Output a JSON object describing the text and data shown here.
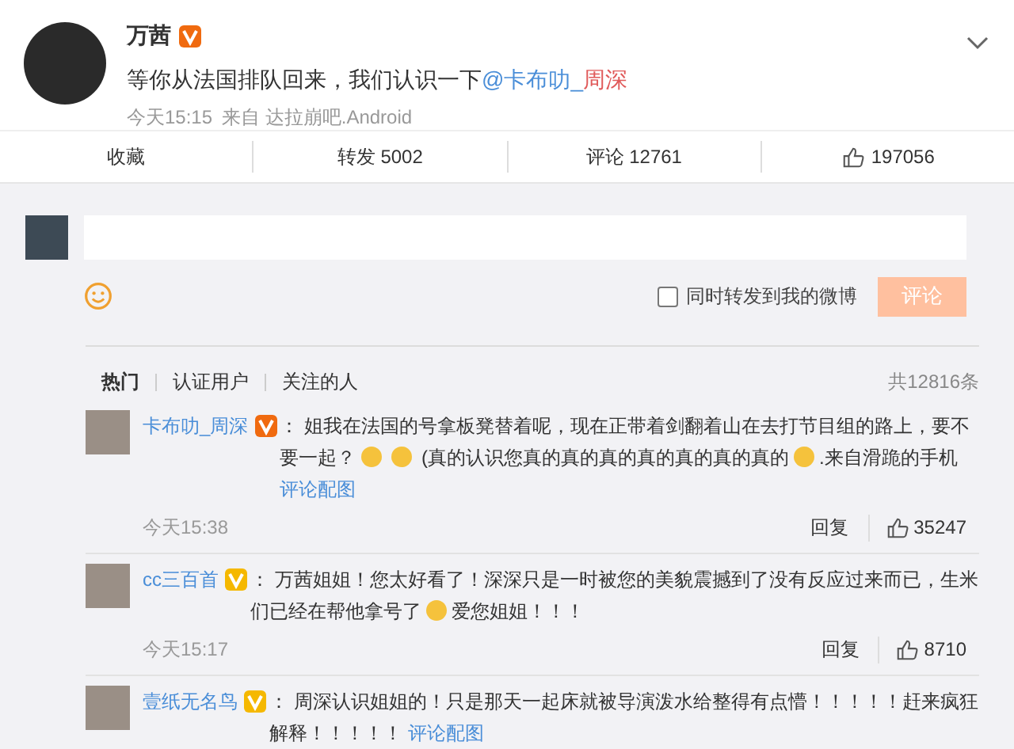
{
  "post": {
    "author": "万茜",
    "color": "#f06a0f",
    "parts": [
      {
        "kind": "text",
        "text": "等你从法国排队回来，我们认识一下"
      },
      {
        "kind": "link",
        "text": "@卡布叻_"
      },
      {
        "kind": "highlight",
        "text": "周深"
      }
    ],
    "time": "今天15:15",
    "source": "来自 达拉崩吧.Android"
  },
  "actions": [
    {
      "kind": "text",
      "label": "收藏"
    },
    {
      "kind": "text",
      "label": "转发 5002"
    },
    {
      "kind": "text",
      "label": "评论 12761"
    },
    {
      "kind": "like",
      "label": "197056"
    }
  ],
  "composer": {
    "repost_label": "同时转发到我的微博",
    "repost_checked": false,
    "submit": "评论",
    "submit_disabled": true
  },
  "filters": [
    {
      "label": "热门",
      "selected": true
    },
    {
      "label": "认证用户",
      "selected": false
    },
    {
      "label": "关注的人",
      "selected": false
    }
  ],
  "total": "共12816条",
  "comments": [
    {
      "author": "卡布叻_周深",
      "color": "#f06a0f",
      "parts": [
        {
          "kind": "text",
          "text": "：  姐我在法国的号拿板凳替着呢，现在正带着剑翻着山在去打节目组的路上，要不要一起？"
        },
        {
          "kind": "emoji"
        },
        {
          "kind": "emoji"
        },
        {
          "kind": "text",
          "text": "  (真的认识您真的真的真的真的真的真的真的"
        },
        {
          "kind": "emoji"
        },
        {
          "kind": "text",
          "text": ".来自滑跪的手机 "
        },
        {
          "kind": "link",
          "text": "评论配图"
        }
      ],
      "time": "今天15:38",
      "reply": "回复",
      "likes": "35247"
    },
    {
      "author": "cc三百首",
      "color": "#f5b800",
      "parts": [
        {
          "kind": "text",
          "text": "：  万茜姐姐！您太好看了！深深只是一时被您的美貌震撼到了没有反应过来而已，生米们已经在帮他拿号了"
        },
        {
          "kind": "emoji"
        },
        {
          "kind": "text",
          "text": "爱您姐姐！！！"
        }
      ],
      "time": "今天15:17",
      "reply": "回复",
      "likes": "8710"
    },
    {
      "author": "壹纸无名鸟",
      "color": "#f5b800",
      "parts": [
        {
          "kind": "text",
          "text": "：  周深认识姐姐的！只是那天一起床就被导演泼水给整得有点懵！！！！！赶来疯狂解释！！！！！ "
        },
        {
          "kind": "link",
          "text": "评论配图"
        }
      ]
    }
  ]
}
